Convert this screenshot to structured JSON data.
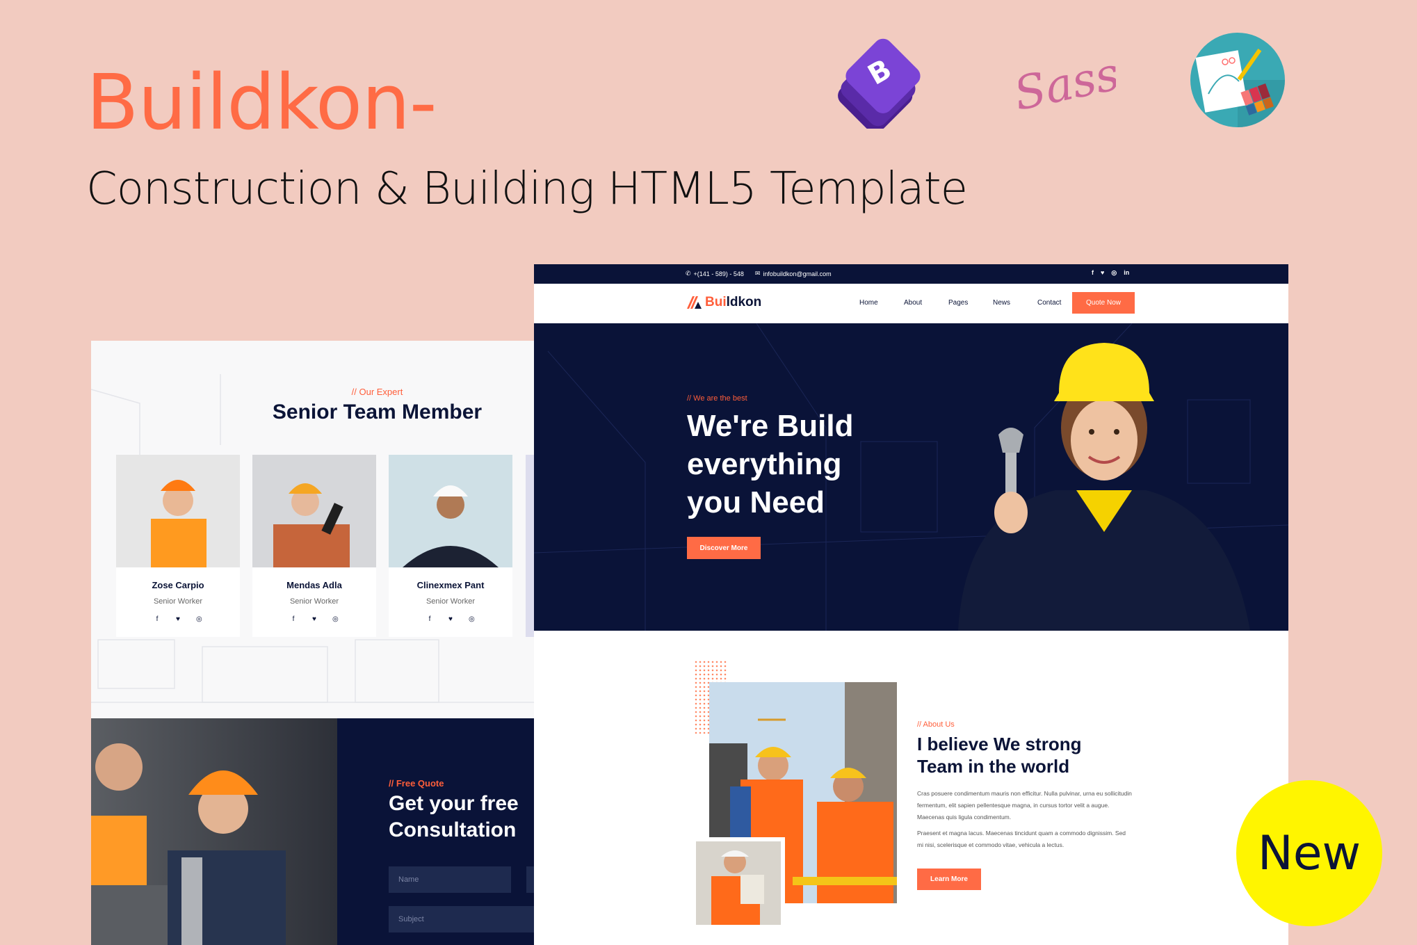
{
  "banner": {
    "title": "Buildkon-",
    "subtitle": "Construction & Building HTML5 Template",
    "logos": [
      "bootstrap-logo",
      "sass-logo",
      "design-palette-logo"
    ],
    "sass_text": "Sass",
    "bootstrap_letter": "B"
  },
  "colors": {
    "accent": "#ff6b45",
    "navy": "#0a1338",
    "background": "#f2cbc0",
    "badge": "#fff500"
  },
  "team": {
    "tag": "// Our Expert",
    "title": "Senior Team Member",
    "members": [
      {
        "name": "Zose Carpio",
        "role": "Senior Worker"
      },
      {
        "name": "Mendas Adla",
        "role": "Senior Worker"
      },
      {
        "name": "Clinexmex Pant",
        "role": "Senior Worker"
      }
    ],
    "social_icons": [
      "f",
      "ẏ",
      "◎"
    ]
  },
  "quote": {
    "tag": "// Free Quote",
    "title_line1": "Get your free",
    "title_line2": "Consultation",
    "name_placeholder": "Name",
    "subject_placeholder": "Subject"
  },
  "topbar": {
    "phone": "+(141 - 589) - 548",
    "email": "infobuildkon@gmail.com",
    "social": [
      "f",
      "t",
      "◎",
      "in"
    ]
  },
  "nav": {
    "logo_accent": "Bui",
    "logo_rest": "ldkon",
    "links": [
      "Home",
      "About",
      "Pages",
      "News",
      "Contact"
    ],
    "cta": "Quote Now"
  },
  "hero": {
    "tag": "// We are the best",
    "title_line1": "We're Build",
    "title_line2": "everything",
    "title_line3": "you Need",
    "button": "Discover More"
  },
  "about": {
    "tag": "// About Us",
    "title_line1": "I believe We strong",
    "title_line2": "Team in the world",
    "p1": "Cras posuere condimentum mauris non efficitur. Nulla pulvinar, urna eu sollicitudin fermentum, elit sapien pellentesque magna, in cursus tortor velit a augue. Maecenas quis ligula condimentum.",
    "p2": "Praesent et magna lacus. Maecenas tincidunt quam a commodo dignissim. Sed mi nisi, scelerisque et commodo vitae, vehicula a lectus.",
    "button": "Learn More"
  },
  "badge": {
    "label": "New"
  }
}
